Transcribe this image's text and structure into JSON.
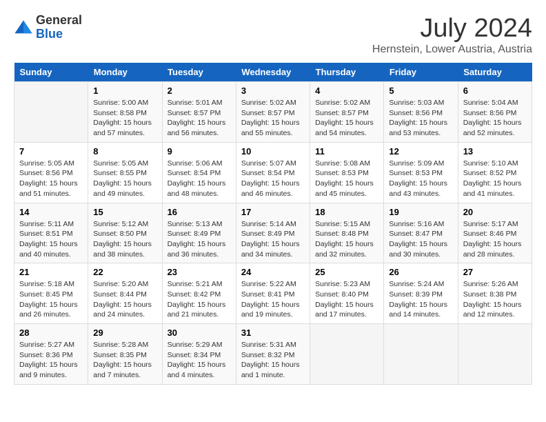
{
  "logo": {
    "general": "General",
    "blue": "Blue"
  },
  "title": "July 2024",
  "subtitle": "Hernstein, Lower Austria, Austria",
  "days_header": [
    "Sunday",
    "Monday",
    "Tuesday",
    "Wednesday",
    "Thursday",
    "Friday",
    "Saturday"
  ],
  "weeks": [
    [
      {
        "num": "",
        "info": ""
      },
      {
        "num": "1",
        "info": "Sunrise: 5:00 AM\nSunset: 8:58 PM\nDaylight: 15 hours\nand 57 minutes."
      },
      {
        "num": "2",
        "info": "Sunrise: 5:01 AM\nSunset: 8:57 PM\nDaylight: 15 hours\nand 56 minutes."
      },
      {
        "num": "3",
        "info": "Sunrise: 5:02 AM\nSunset: 8:57 PM\nDaylight: 15 hours\nand 55 minutes."
      },
      {
        "num": "4",
        "info": "Sunrise: 5:02 AM\nSunset: 8:57 PM\nDaylight: 15 hours\nand 54 minutes."
      },
      {
        "num": "5",
        "info": "Sunrise: 5:03 AM\nSunset: 8:56 PM\nDaylight: 15 hours\nand 53 minutes."
      },
      {
        "num": "6",
        "info": "Sunrise: 5:04 AM\nSunset: 8:56 PM\nDaylight: 15 hours\nand 52 minutes."
      }
    ],
    [
      {
        "num": "7",
        "info": "Sunrise: 5:05 AM\nSunset: 8:56 PM\nDaylight: 15 hours\nand 51 minutes."
      },
      {
        "num": "8",
        "info": "Sunrise: 5:05 AM\nSunset: 8:55 PM\nDaylight: 15 hours\nand 49 minutes."
      },
      {
        "num": "9",
        "info": "Sunrise: 5:06 AM\nSunset: 8:54 PM\nDaylight: 15 hours\nand 48 minutes."
      },
      {
        "num": "10",
        "info": "Sunrise: 5:07 AM\nSunset: 8:54 PM\nDaylight: 15 hours\nand 46 minutes."
      },
      {
        "num": "11",
        "info": "Sunrise: 5:08 AM\nSunset: 8:53 PM\nDaylight: 15 hours\nand 45 minutes."
      },
      {
        "num": "12",
        "info": "Sunrise: 5:09 AM\nSunset: 8:53 PM\nDaylight: 15 hours\nand 43 minutes."
      },
      {
        "num": "13",
        "info": "Sunrise: 5:10 AM\nSunset: 8:52 PM\nDaylight: 15 hours\nand 41 minutes."
      }
    ],
    [
      {
        "num": "14",
        "info": "Sunrise: 5:11 AM\nSunset: 8:51 PM\nDaylight: 15 hours\nand 40 minutes."
      },
      {
        "num": "15",
        "info": "Sunrise: 5:12 AM\nSunset: 8:50 PM\nDaylight: 15 hours\nand 38 minutes."
      },
      {
        "num": "16",
        "info": "Sunrise: 5:13 AM\nSunset: 8:49 PM\nDaylight: 15 hours\nand 36 minutes."
      },
      {
        "num": "17",
        "info": "Sunrise: 5:14 AM\nSunset: 8:49 PM\nDaylight: 15 hours\nand 34 minutes."
      },
      {
        "num": "18",
        "info": "Sunrise: 5:15 AM\nSunset: 8:48 PM\nDaylight: 15 hours\nand 32 minutes."
      },
      {
        "num": "19",
        "info": "Sunrise: 5:16 AM\nSunset: 8:47 PM\nDaylight: 15 hours\nand 30 minutes."
      },
      {
        "num": "20",
        "info": "Sunrise: 5:17 AM\nSunset: 8:46 PM\nDaylight: 15 hours\nand 28 minutes."
      }
    ],
    [
      {
        "num": "21",
        "info": "Sunrise: 5:18 AM\nSunset: 8:45 PM\nDaylight: 15 hours\nand 26 minutes."
      },
      {
        "num": "22",
        "info": "Sunrise: 5:20 AM\nSunset: 8:44 PM\nDaylight: 15 hours\nand 24 minutes."
      },
      {
        "num": "23",
        "info": "Sunrise: 5:21 AM\nSunset: 8:42 PM\nDaylight: 15 hours\nand 21 minutes."
      },
      {
        "num": "24",
        "info": "Sunrise: 5:22 AM\nSunset: 8:41 PM\nDaylight: 15 hours\nand 19 minutes."
      },
      {
        "num": "25",
        "info": "Sunrise: 5:23 AM\nSunset: 8:40 PM\nDaylight: 15 hours\nand 17 minutes."
      },
      {
        "num": "26",
        "info": "Sunrise: 5:24 AM\nSunset: 8:39 PM\nDaylight: 15 hours\nand 14 minutes."
      },
      {
        "num": "27",
        "info": "Sunrise: 5:26 AM\nSunset: 8:38 PM\nDaylight: 15 hours\nand 12 minutes."
      }
    ],
    [
      {
        "num": "28",
        "info": "Sunrise: 5:27 AM\nSunset: 8:36 PM\nDaylight: 15 hours\nand 9 minutes."
      },
      {
        "num": "29",
        "info": "Sunrise: 5:28 AM\nSunset: 8:35 PM\nDaylight: 15 hours\nand 7 minutes."
      },
      {
        "num": "30",
        "info": "Sunrise: 5:29 AM\nSunset: 8:34 PM\nDaylight: 15 hours\nand 4 minutes."
      },
      {
        "num": "31",
        "info": "Sunrise: 5:31 AM\nSunset: 8:32 PM\nDaylight: 15 hours\nand 1 minute."
      },
      {
        "num": "",
        "info": ""
      },
      {
        "num": "",
        "info": ""
      },
      {
        "num": "",
        "info": ""
      }
    ]
  ]
}
